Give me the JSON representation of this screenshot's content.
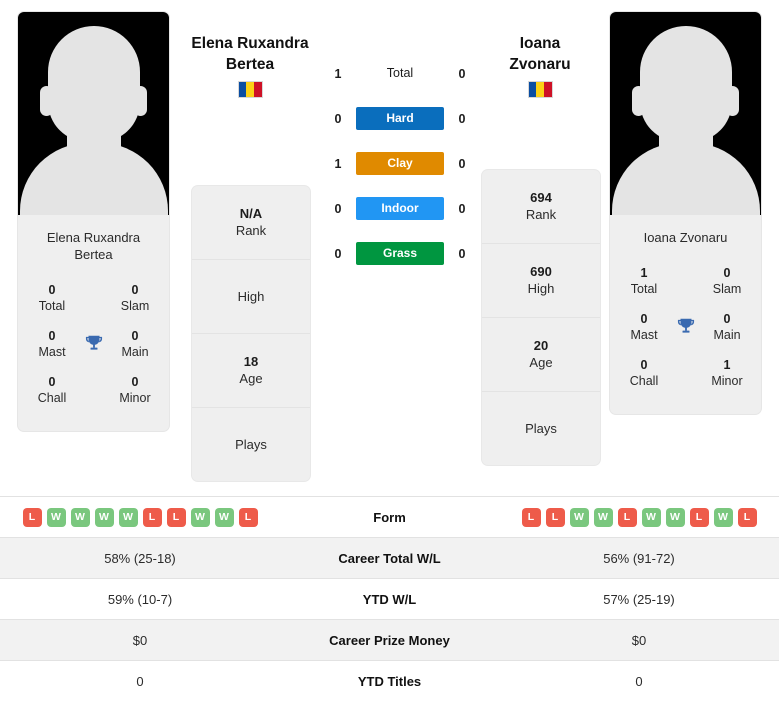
{
  "players": {
    "left": {
      "display_name": "Elena Ruxandra Bertea",
      "heading_line1": "Elena Ruxandra",
      "heading_line2": "Bertea",
      "flag_country": "Romania",
      "titles": {
        "total_value": "0",
        "total_label": "Total",
        "slam_value": "0",
        "slam_label": "Slam",
        "mast_value": "0",
        "mast_label": "Mast",
        "main_value": "0",
        "main_label": "Main",
        "chall_value": "0",
        "chall_label": "Chall",
        "minor_value": "0",
        "minor_label": "Minor"
      },
      "info": [
        {
          "value": "N/A",
          "label": "Rank"
        },
        {
          "value": "",
          "label": "High"
        },
        {
          "value": "18",
          "label": "Age"
        },
        {
          "value": "",
          "label": "Plays"
        }
      ],
      "form": [
        "L",
        "W",
        "W",
        "W",
        "W",
        "L",
        "L",
        "W",
        "W",
        "L"
      ],
      "career_total_wl": "58% (25-18)",
      "ytd_wl": "59% (10-7)",
      "career_prize_money": "$0",
      "ytd_titles": "0"
    },
    "right": {
      "display_name": "Ioana Zvonaru",
      "heading_line1": "Ioana",
      "heading_line2": "Zvonaru",
      "flag_country": "Romania",
      "titles": {
        "total_value": "1",
        "total_label": "Total",
        "slam_value": "0",
        "slam_label": "Slam",
        "mast_value": "0",
        "mast_label": "Mast",
        "main_value": "0",
        "main_label": "Main",
        "chall_value": "0",
        "chall_label": "Chall",
        "minor_value": "1",
        "minor_label": "Minor"
      },
      "info": [
        {
          "value": "694",
          "label": "Rank"
        },
        {
          "value": "690",
          "label": "High"
        },
        {
          "value": "20",
          "label": "Age"
        },
        {
          "value": "",
          "label": "Plays"
        }
      ],
      "form": [
        "L",
        "L",
        "W",
        "W",
        "L",
        "W",
        "W",
        "L",
        "W",
        "L"
      ],
      "career_total_wl": "56% (91-72)",
      "ytd_wl": "57% (25-19)",
      "career_prize_money": "$0",
      "ytd_titles": "0"
    }
  },
  "head_to_head": {
    "rows": [
      {
        "label": "Total",
        "left": "1",
        "right": "0",
        "color": ""
      },
      {
        "label": "Hard",
        "left": "0",
        "right": "0",
        "color": "#0a6ebd"
      },
      {
        "label": "Clay",
        "left": "1",
        "right": "0",
        "color": "#e08a00"
      },
      {
        "label": "Indoor",
        "left": "0",
        "right": "0",
        "color": "#2196f3"
      },
      {
        "label": "Grass",
        "left": "0",
        "right": "0",
        "color": "#009640"
      }
    ]
  },
  "stats_table": {
    "rows": [
      {
        "label": "Form",
        "type": "form"
      },
      {
        "label": "Career Total W/L",
        "type": "text",
        "key": "career_total_wl"
      },
      {
        "label": "YTD W/L",
        "type": "text",
        "key": "ytd_wl"
      },
      {
        "label": "Career Prize Money",
        "type": "text",
        "key": "career_prize_money"
      },
      {
        "label": "YTD Titles",
        "type": "text",
        "key": "ytd_titles"
      }
    ]
  },
  "colors": {
    "win_badge": "#7ac77e",
    "loss_badge": "#ee5b4a",
    "card_bg": "#efefef",
    "row_shade": "#f2f2f2",
    "trophy": "#3a6ab0"
  }
}
